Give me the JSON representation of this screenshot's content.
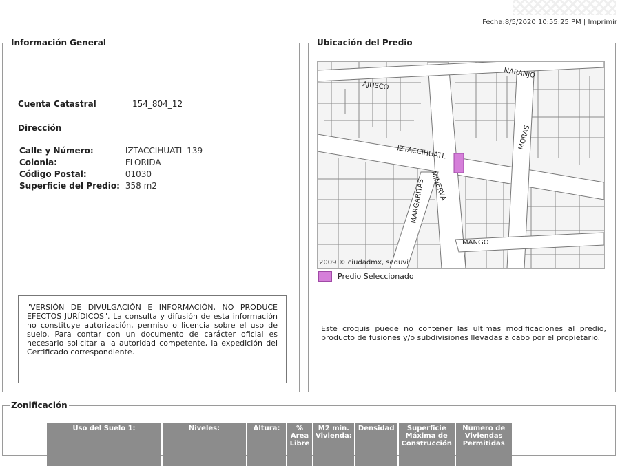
{
  "header": {
    "fecha_label": "Fecha:",
    "fecha_value": "8/5/2020 10:55:25 PM",
    "separator": " | ",
    "imprimir": "Imprimir"
  },
  "info_general": {
    "title": "Información General",
    "cuenta_label": "Cuenta Catastral",
    "cuenta_value": "154_804_12",
    "direccion_label": "Dirección",
    "fields": [
      {
        "label": "Calle y Número:",
        "value": "IZTACCIHUATL 139"
      },
      {
        "label": "Colonia:",
        "value": "FLORIDA"
      },
      {
        "label": "Código Postal:",
        "value": "01030"
      },
      {
        "label": "Superficie del Predio:",
        "value": "358 m2"
      }
    ],
    "disclaimer": "\"VERSIÓN DE DIVULGACIÓN E INFORMACIÓN, NO PRODUCE EFECTOS JURÍDICOS\". La consulta y difusión de esta información no constituye autorización, permiso o licencia sobre el uso de suelo. Para contar con un documento de carácter oficial es necesario solicitar a la autoridad competente, la expedición del Certificado correspondiente."
  },
  "ubicacion": {
    "title": "Ubicación del Predio",
    "map_labels": {
      "ajusco": "AJUSCO",
      "naranjo": "NARANJO",
      "iztaccihuatl": "IZTACCIHUATL",
      "moras": "MORAS",
      "margaritas": "MARGARITAS",
      "minerva": "MINERVA",
      "mango": "MANGO",
      "credit": "2009 © ciudadmx, seduvi"
    },
    "legend_label": "Predio Seleccionado",
    "highlight_color": "#d57fd9",
    "note": "Este croquis puede no contener las ultimas modificaciones al predio, producto de fusiones y/o subdivisiones llevadas a cabo por el propietario."
  },
  "zonificacion": {
    "title": "Zonificación",
    "columns": [
      "Uso del Suelo 1:",
      "Niveles:",
      "Altura:",
      "% Área Libre",
      "M2 min. Vivienda:",
      "Densidad",
      "Superficie Máxima de Construcción",
      "Número de Viviendas Permitidas"
    ]
  }
}
